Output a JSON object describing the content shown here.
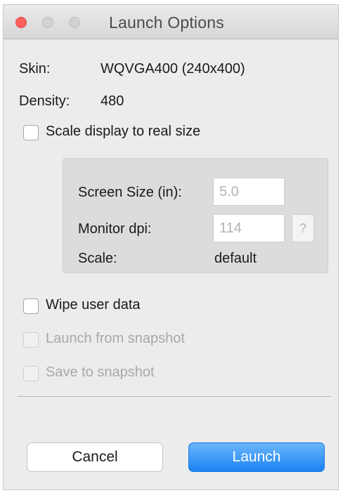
{
  "window": {
    "title": "Launch Options"
  },
  "info": {
    "skin_label": "Skin:",
    "skin_value": "WQVGA400 (240x400)",
    "density_label": "Density:",
    "density_value": "480"
  },
  "options": {
    "scale_display": {
      "label": "Scale display to real size",
      "checked": false,
      "enabled": true
    },
    "wipe_user_data": {
      "label": "Wipe user data",
      "checked": false,
      "enabled": true
    },
    "launch_from_snapshot": {
      "label": "Launch from snapshot",
      "checked": false,
      "enabled": false
    },
    "save_to_snapshot": {
      "label": "Save to snapshot",
      "checked": false,
      "enabled": false
    }
  },
  "scale_group": {
    "screen_size_label": "Screen Size (in):",
    "screen_size_value": "5.0",
    "monitor_dpi_label": "Monitor dpi:",
    "monitor_dpi_value": "114",
    "help_label": "?",
    "scale_label": "Scale:",
    "scale_value": "default"
  },
  "buttons": {
    "cancel": "Cancel",
    "launch": "Launch"
  },
  "colors": {
    "accent": "#1a82f3",
    "close": "#fc605c"
  }
}
